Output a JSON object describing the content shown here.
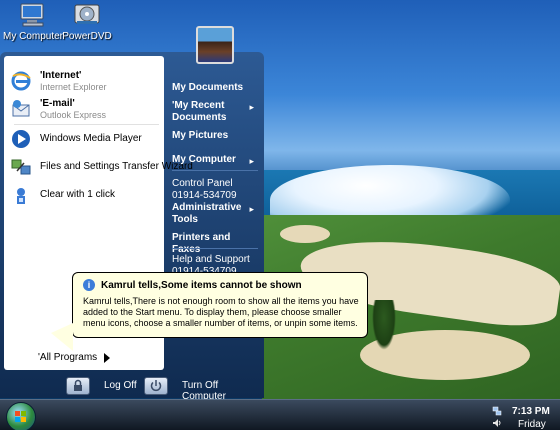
{
  "desktop": {
    "icons": [
      {
        "label": "My Computer"
      },
      {
        "label": "PowerDVD"
      }
    ]
  },
  "start_menu": {
    "pinned": [
      {
        "title": "'Internet'",
        "subtitle": "Internet Explorer"
      },
      {
        "title": "'E-mail'",
        "subtitle": "Outlook Express"
      }
    ],
    "recent": [
      {
        "label": "Windows Media Player"
      },
      {
        "label": "Files and Settings Transfer Wizard"
      },
      {
        "label": "Clear with 1 click"
      }
    ],
    "all_programs": "'All Programs",
    "right_items": [
      {
        "label": "My Documents"
      },
      {
        "label": "'My Recent Documents"
      },
      {
        "label": "My Pictures"
      },
      {
        "label": "My Computer"
      },
      {
        "label": "Control Panel 01914-534709"
      },
      {
        "label": "Administrative Tools"
      },
      {
        "label": "Printers and Faxes"
      },
      {
        "label": "Help and Support 01914-534709"
      }
    ],
    "log_off": "Log Off",
    "turn_off": "Turn Off Computer"
  },
  "balloon": {
    "title": "Kamrul tells,Some items cannot be shown",
    "body": "Kamrul tells,There is not enough room to show all the items you have added to the Start menu.  To display them, please choose smaller menu icons, choose a smaller number of items, or unpin some items."
  },
  "taskbar": {
    "time": "7:13 PM",
    "day": "Friday"
  }
}
